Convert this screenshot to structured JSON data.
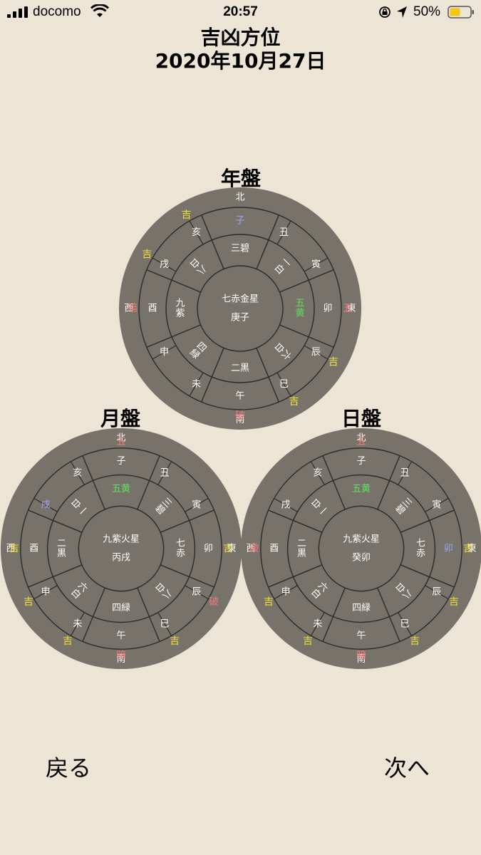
{
  "status": {
    "carrier": "docomo",
    "time": "20:57",
    "battery": "50%"
  },
  "title": {
    "line1": "吉凶方位",
    "line2": "2020年10月27日"
  },
  "colors": {
    "bg": "#ece4d4",
    "disc": "#77736a",
    "line": "#2b2b2b",
    "text": "#ffffff",
    "kichi": "#f3e13b",
    "bad": "#f07a7a",
    "gohou": "#a0a6f2",
    "gouou": "#5fe05f",
    "battery": "#f5c518"
  },
  "boards": [
    {
      "id": "year",
      "label": "年盤",
      "center_star": "七赤金星",
      "center_kanshi": "庚子",
      "stars": [
        "三碧",
        "一白",
        "五黄",
        "六白",
        "二黒",
        "四緑",
        "九紫",
        "八白"
      ],
      "star_color": [
        "text",
        "text",
        "gouou",
        "text",
        "text",
        "text",
        "text",
        "text"
      ],
      "branches": [
        "子",
        "丑",
        "寅",
        "卯",
        "辰",
        "巳",
        "午",
        "未",
        "申",
        "酉",
        "戌",
        "亥"
      ],
      "branch_color": [
        "gohou",
        "text",
        "text",
        "text",
        "text",
        "text",
        "text",
        "text",
        "text",
        "text",
        "text",
        "text"
      ],
      "outer": [
        "",
        "",
        "",
        "五",
        "吉",
        "吉",
        "破",
        "",
        "",
        "暗",
        "吉",
        "吉"
      ],
      "outer_color": [
        "",
        "",
        "",
        "bad",
        "kichi",
        "kichi",
        "bad",
        "",
        "",
        "bad",
        "kichi",
        "kichi"
      ],
      "dirs": [
        "北",
        "東",
        "南",
        "西"
      ]
    },
    {
      "id": "month",
      "label": "月盤",
      "center_star": "九紫火星",
      "center_kanshi": "丙戌",
      "stars": [
        "五黄",
        "三碧",
        "七赤",
        "八白",
        "四緑",
        "六白",
        "二黒",
        "一白"
      ],
      "star_color": [
        "gouou",
        "text",
        "text",
        "text",
        "text",
        "text",
        "text",
        "text"
      ],
      "branches": [
        "子",
        "丑",
        "寅",
        "卯",
        "辰",
        "巳",
        "午",
        "未",
        "申",
        "酉",
        "戌",
        "亥"
      ],
      "branch_color": [
        "text",
        "text",
        "text",
        "text",
        "text",
        "text",
        "text",
        "text",
        "text",
        "text",
        "gohou",
        "text"
      ],
      "outer": [
        "五",
        "",
        "",
        "吉",
        "破",
        "吉",
        "暗",
        "吉",
        "吉",
        "吉",
        "",
        ""
      ],
      "outer_color": [
        "bad",
        "",
        "",
        "kichi",
        "bad",
        "kichi",
        "bad",
        "kichi",
        "kichi",
        "kichi",
        "",
        ""
      ],
      "dirs": [
        "北",
        "東",
        "南",
        "西"
      ]
    },
    {
      "id": "day",
      "label": "日盤",
      "center_star": "九紫火星",
      "center_kanshi": "癸卯",
      "stars": [
        "五黄",
        "三碧",
        "七赤",
        "八白",
        "四緑",
        "六白",
        "二黒",
        "一白"
      ],
      "star_color": [
        "gouou",
        "text",
        "text",
        "text",
        "text",
        "text",
        "text",
        "text"
      ],
      "branches": [
        "子",
        "丑",
        "寅",
        "卯",
        "辰",
        "巳",
        "午",
        "未",
        "申",
        "酉",
        "戌",
        "亥"
      ],
      "branch_color": [
        "text",
        "text",
        "text",
        "gohou",
        "text",
        "text",
        "text",
        "text",
        "text",
        "text",
        "text",
        "text"
      ],
      "outer": [
        "五",
        "",
        "",
        "吉",
        "吉",
        "吉",
        "暗",
        "吉",
        "吉",
        "破",
        "",
        ""
      ],
      "outer_color": [
        "bad",
        "",
        "",
        "kichi",
        "kichi",
        "kichi",
        "bad",
        "kichi",
        "kichi",
        "bad",
        "",
        ""
      ],
      "dirs": [
        "北",
        "東",
        "南",
        "西"
      ]
    }
  ],
  "nav": {
    "back": "戻る",
    "next": "次へ"
  }
}
